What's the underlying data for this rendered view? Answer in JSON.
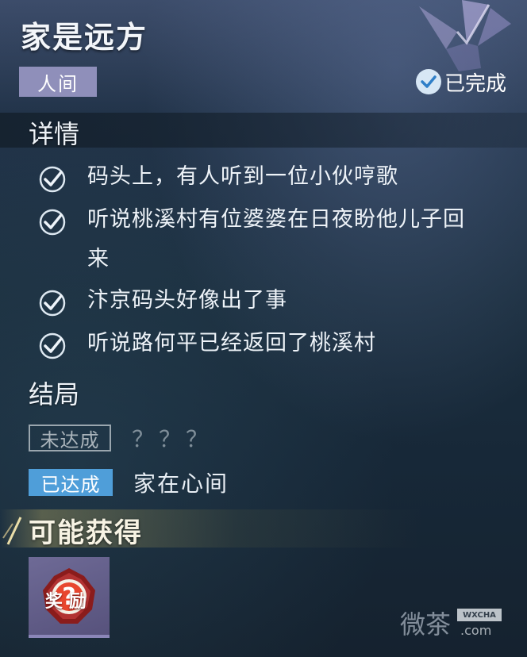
{
  "quest": {
    "title": "家是远方",
    "realm_tag": "人间",
    "status_label": "已完成"
  },
  "details": {
    "heading": "详情",
    "clues": [
      {
        "text": "码头上，有人听到一位小伙哼歌",
        "done": true
      },
      {
        "text": "听说桃溪村有位婆婆在日夜盼他儿子回来",
        "done": true
      },
      {
        "text": "汴京码头好像出了事",
        "done": true
      },
      {
        "text": "听说路何平已经返回了桃溪村",
        "done": true
      }
    ]
  },
  "endings": {
    "heading": "结局",
    "items": [
      {
        "badge": "未达成",
        "text": "？？？",
        "reached": false
      },
      {
        "badge": "已达成",
        "text": "家在心间",
        "reached": true
      }
    ]
  },
  "rewards": {
    "heading": "可能获得",
    "items": [
      {
        "label": "奖励",
        "icon": "mystery-reward-icon"
      }
    ]
  },
  "watermark": {
    "text": "微茶",
    "badge": "WXCHA",
    "domain": ".com"
  },
  "colors": {
    "realm_tag_bg": "#8f8fba",
    "reached_badge_bg": "#4f9ed9",
    "check_circle": "#d7e7f5"
  }
}
